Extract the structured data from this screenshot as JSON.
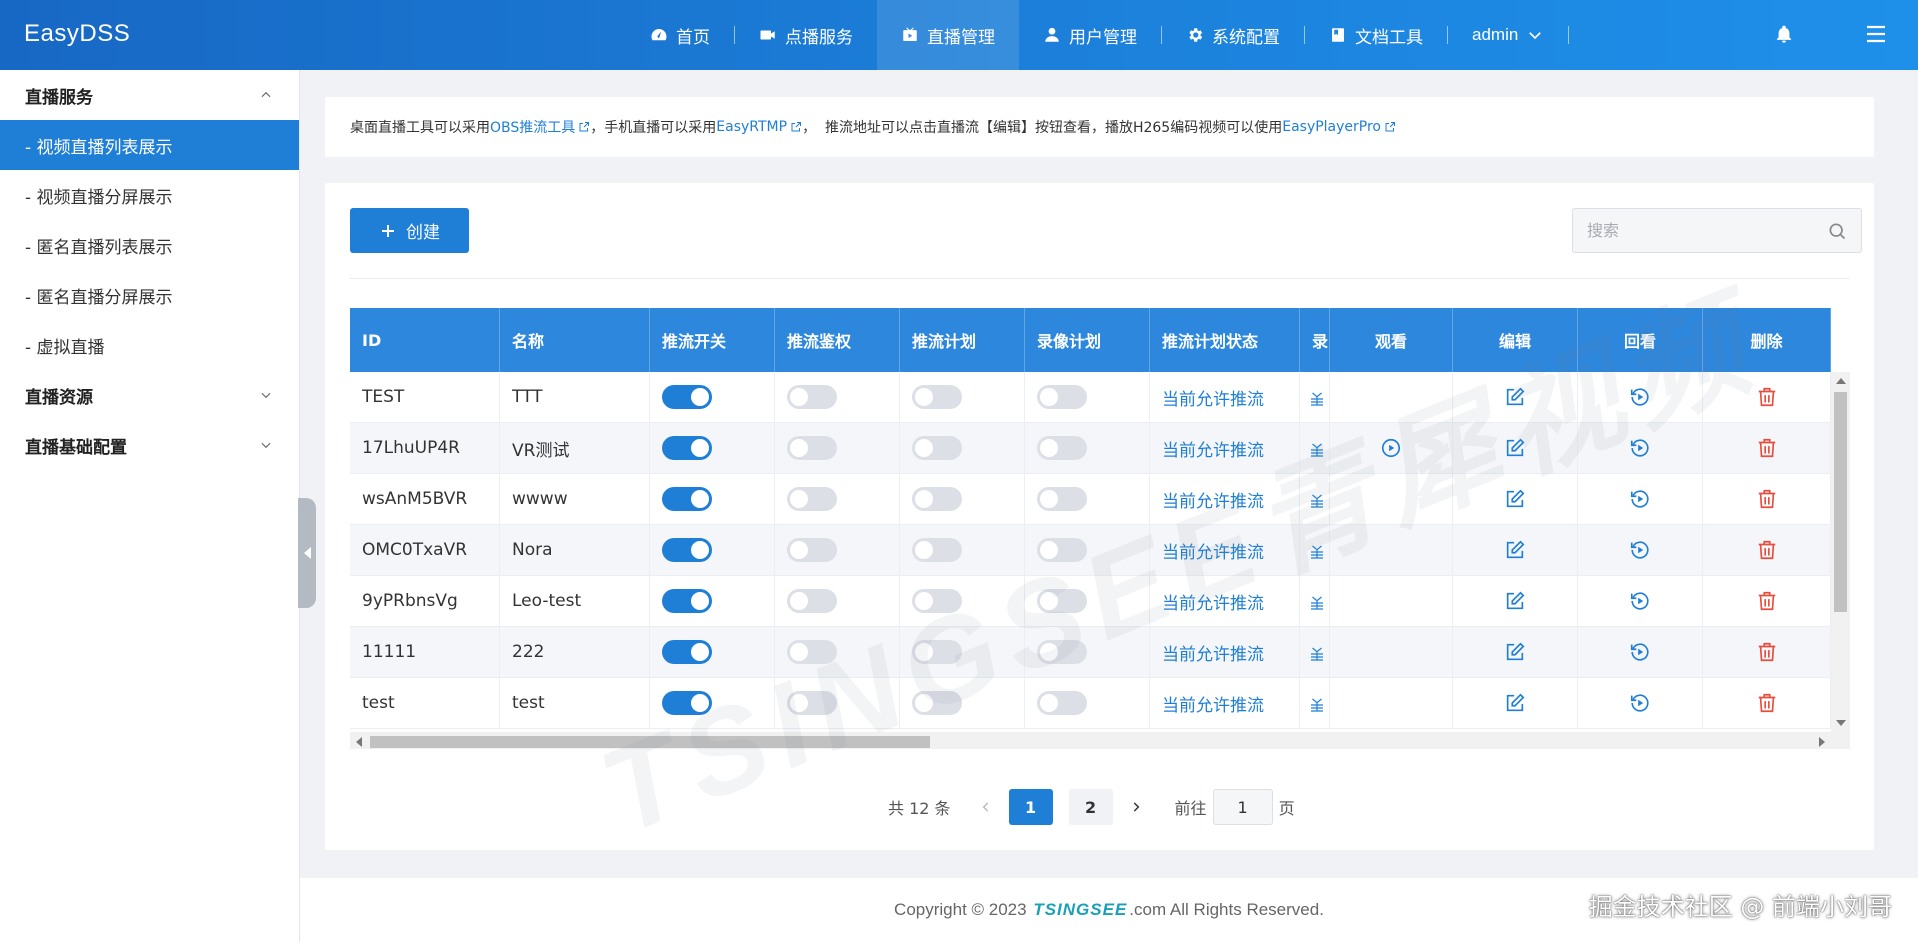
{
  "header": {
    "brand": "EasyDSS",
    "nav": [
      {
        "label": "首页",
        "icon": "dashboard-icon"
      },
      {
        "label": "点播服务",
        "icon": "video-camera-icon"
      },
      {
        "label": "直播管理",
        "icon": "live-tv-icon",
        "active": true
      },
      {
        "label": "用户管理",
        "icon": "user-icon"
      },
      {
        "label": "系统配置",
        "icon": "gear-icon"
      },
      {
        "label": "文档工具",
        "icon": "document-icon"
      }
    ],
    "user": "admin"
  },
  "sidebar": {
    "groups": [
      {
        "label": "直播服务",
        "expanded": true,
        "items": [
          {
            "label": "- 视频直播列表展示",
            "active": true
          },
          {
            "label": "- 视频直播分屏展示"
          },
          {
            "label": "- 匿名直播列表展示"
          },
          {
            "label": "- 匿名直播分屏展示"
          },
          {
            "label": "- 虚拟直播"
          }
        ]
      },
      {
        "label": "直播资源",
        "expanded": false
      },
      {
        "label": "直播基础配置",
        "expanded": false
      }
    ]
  },
  "notice": {
    "t1": "桌面直播工具可以采用",
    "l1": "OBS推流工具",
    "t2": "，手机直播可以采用",
    "l2": "EasyRTMP",
    "t3": "，  推流地址可以点击直播流【编辑】按钮查看，播放H265编码视频可以使用",
    "l3": "EasyPlayerPro"
  },
  "toolbar": {
    "create_label": "创建",
    "search_placeholder": "搜索"
  },
  "table": {
    "columns": [
      "ID",
      "名称",
      "推流开关",
      "推流鉴权",
      "推流计划",
      "录像计划",
      "推流计划状态",
      "录",
      "观看",
      "编辑",
      "回看",
      "删除"
    ],
    "rows": [
      {
        "id": "TEST",
        "name": "TTT",
        "push": true,
        "auth": false,
        "plan": false,
        "record": false,
        "status": "当前允许推流",
        "watch": false
      },
      {
        "id": "17LhuUP4R",
        "name": "VR测试",
        "push": true,
        "auth": false,
        "plan": false,
        "record": false,
        "status": "当前允许推流",
        "watch": true
      },
      {
        "id": "wsAnM5BVR",
        "name": "wwww",
        "push": true,
        "auth": false,
        "plan": false,
        "record": false,
        "status": "当前允许推流",
        "watch": false
      },
      {
        "id": "OMC0TxaVR",
        "name": "Nora",
        "push": true,
        "auth": false,
        "plan": false,
        "record": false,
        "status": "当前允许推流",
        "watch": false
      },
      {
        "id": "9yPRbnsVg",
        "name": "Leo-test",
        "push": true,
        "auth": false,
        "plan": false,
        "record": false,
        "status": "当前允许推流",
        "watch": false
      },
      {
        "id": "11111",
        "name": "222",
        "push": true,
        "auth": false,
        "plan": false,
        "record": false,
        "status": "当前允许推流",
        "watch": false
      },
      {
        "id": "test",
        "name": "test",
        "push": true,
        "auth": false,
        "plan": false,
        "record": false,
        "status": "当前允许推流",
        "watch": false
      }
    ]
  },
  "pagination": {
    "total": "共 12 条",
    "pages": [
      "1",
      "2"
    ],
    "current": "1",
    "goto_prefix": "前往",
    "goto_value": "1",
    "goto_suffix": "页"
  },
  "footer": {
    "prefix": "Copyright © 2023",
    "brand": "TSINGSEE",
    "suffix": ".com All Rights Reserved."
  },
  "watermark_tag": "掘金技术社区 @ 前端小刘哥",
  "watermark_main": "TSINGSEE青犀视频",
  "colors": {
    "accent": "#1f7fd6",
    "header": "#1c82dc",
    "delete": "#e74c3c"
  }
}
